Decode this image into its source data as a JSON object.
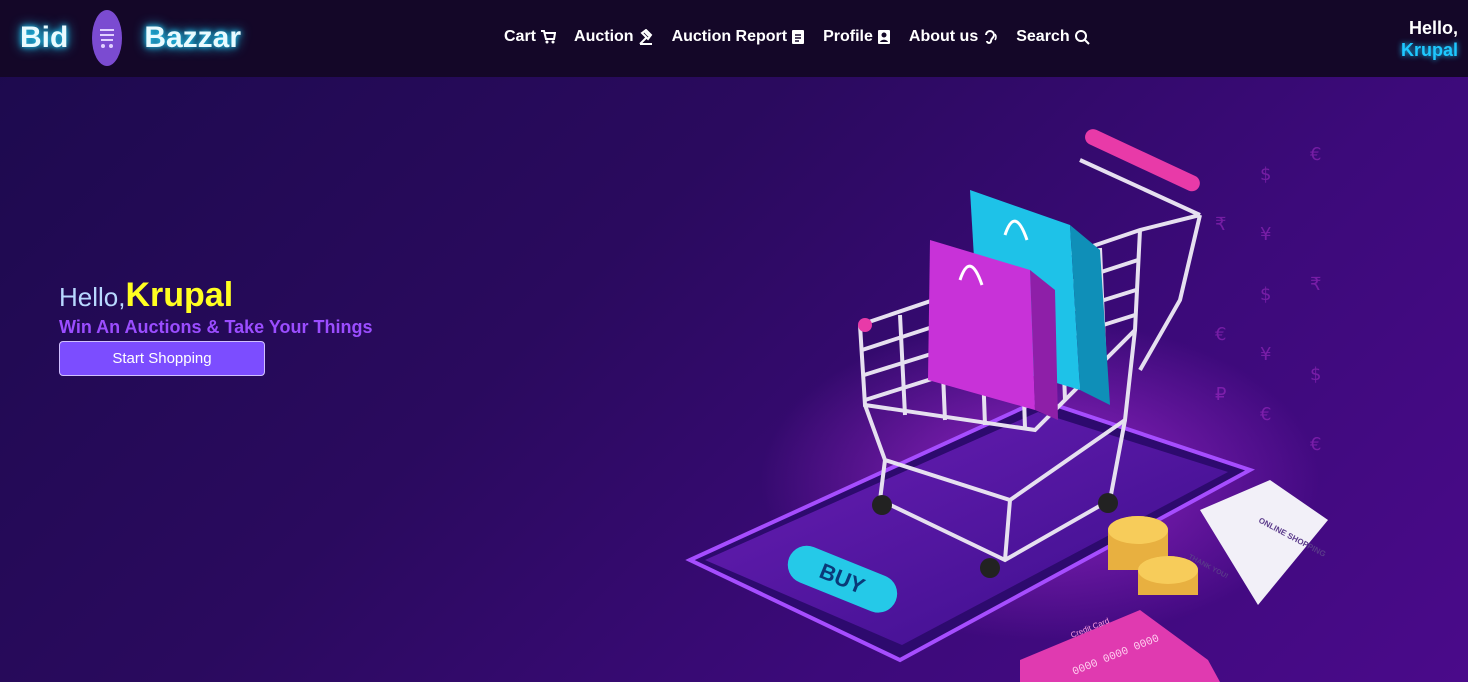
{
  "brand": {
    "word1": "Bid",
    "word2": "Bazzar"
  },
  "nav": {
    "items": [
      {
        "label": "Cart",
        "icon": "cart-icon"
      },
      {
        "label": "Auction",
        "icon": "gavel-icon"
      },
      {
        "label": "Auction Report",
        "icon": "report-icon"
      },
      {
        "label": "Profile",
        "icon": "profile-card-icon"
      },
      {
        "label": "About us",
        "icon": "ear-icon"
      },
      {
        "label": "Search",
        "icon": "search-icon"
      }
    ]
  },
  "greeting": {
    "hello": "Hello,",
    "username": "Krupal"
  },
  "hero": {
    "hello": "Hello,",
    "name": "Krupal",
    "subtitle": "Win An Auctions & Take Your Things",
    "button_label": "Start Shopping"
  },
  "illustration": {
    "buy_label": "BUY",
    "receipt_title": "ONLINE SHOPPING",
    "receipt_thanks": "THANK YOU!",
    "card_label": "Credit Card",
    "card_number": "0000 0000 0000"
  },
  "colors": {
    "accent": "#7c4dff",
    "name": "#ffff21",
    "subtitle": "#9b4dff",
    "glow": "#1ec8ff"
  }
}
